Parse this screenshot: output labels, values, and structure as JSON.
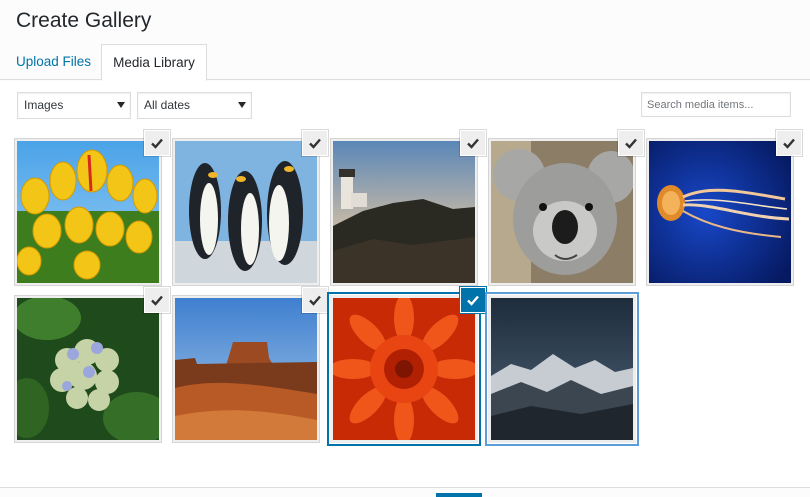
{
  "modal": {
    "title": "Create Gallery"
  },
  "tabs": [
    {
      "label": "Upload Files",
      "active": false
    },
    {
      "label": "Media Library",
      "active": true
    }
  ],
  "filters": {
    "type": "Images",
    "date": "All dates",
    "search_placeholder": "Search media items..."
  },
  "colors": {
    "accent": "#0073aa",
    "focus": "#5b9dd9",
    "link": "#0073aa"
  },
  "attachments": [
    {
      "subject": "tulips",
      "selected": false,
      "checked": true
    },
    {
      "subject": "penguins",
      "selected": false,
      "checked": true
    },
    {
      "subject": "lighthouse",
      "selected": false,
      "checked": true
    },
    {
      "subject": "koala",
      "selected": false,
      "checked": true
    },
    {
      "subject": "jellyfish",
      "selected": false,
      "checked": true
    },
    {
      "subject": "hydrangeas",
      "selected": false,
      "checked": true
    },
    {
      "subject": "desert",
      "selected": false,
      "checked": true
    },
    {
      "subject": "chrysanthemum",
      "selected": true,
      "checked": true
    },
    {
      "subject": "mountains",
      "selected": false,
      "checked": false
    }
  ]
}
